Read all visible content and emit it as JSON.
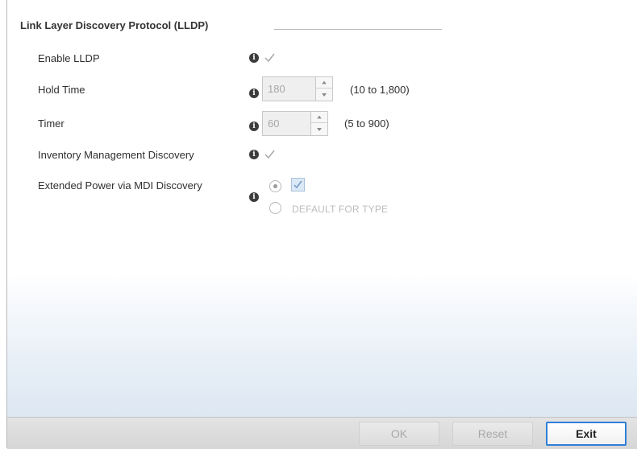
{
  "section": {
    "title": "Link Layer Discovery Protocol (LLDP)"
  },
  "fields": {
    "enable_lldp": {
      "label": "Enable LLDP",
      "checked": true
    },
    "hold_time": {
      "label": "Hold Time",
      "value": "180",
      "range": "(10 to 1,800)"
    },
    "timer": {
      "label": "Timer",
      "value": "60",
      "range": "(5 to 900)"
    },
    "inventory_management_discovery": {
      "label": "Inventory Management Discovery",
      "checked": true
    },
    "extended_power_mdi": {
      "label": "Extended Power via MDI Discovery",
      "option_custom_checked": true,
      "option_default_label": "DEFAULT FOR TYPE"
    }
  },
  "icons": {
    "info": "info-icon",
    "check": "check-icon",
    "spin_up": "chevron-up-icon",
    "spin_down": "chevron-down-icon"
  },
  "footer": {
    "ok_label": "OK",
    "reset_label": "Reset",
    "exit_label": "Exit"
  },
  "colors": {
    "accent": "#2f7ed8",
    "disabled_text": "#a9a9a9",
    "panel_gradient_end": "#dde7f2"
  }
}
